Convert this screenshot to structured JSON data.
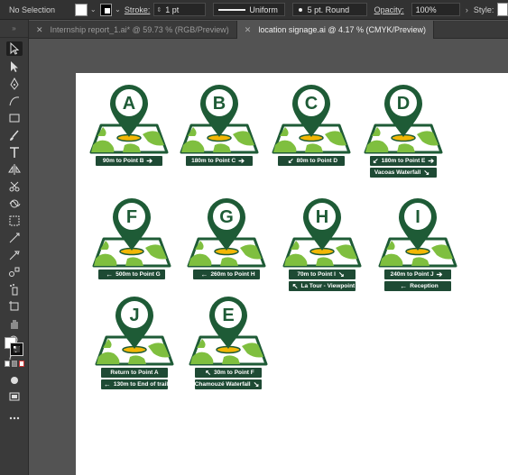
{
  "control_bar": {
    "selection_label": "No Selection",
    "stroke_label": "Stroke:",
    "stroke_value": "1 pt",
    "profile_value": "Uniform",
    "brush_value": "5 pt. Round",
    "opacity_label": "Opacity:",
    "opacity_value": "100%",
    "style_label": "Style:"
  },
  "tabs": [
    {
      "label": "Internship report_1.ai* @ 59.73 % (RGB/Preview)",
      "active": false
    },
    {
      "label": "location signage.ai @ 4.17 % (CMYK/Preview)",
      "active": true
    }
  ],
  "colors": {
    "pin_dark": "#1e5b36",
    "map_light": "#ffffff",
    "map_green": "#7fbf3f",
    "center_yellow": "#f2b705",
    "plate": "#1e4a34"
  },
  "signs": [
    {
      "letter": "A",
      "lines": [
        {
          "text": "90m  to Point B",
          "left_arrow": "",
          "right_arrow": "➔"
        }
      ]
    },
    {
      "letter": "B",
      "lines": [
        {
          "text": "180m  to Point C",
          "left_arrow": "",
          "right_arrow": "➔"
        }
      ]
    },
    {
      "letter": "C",
      "lines": [
        {
          "text": "80m  to Point D",
          "left_arrow": "↙",
          "right_arrow": ""
        }
      ]
    },
    {
      "letter": "D",
      "lines": [
        {
          "text": "180m  to Point E",
          "left_arrow": "↙",
          "right_arrow": "➔"
        },
        {
          "text": "Vacoas Waterfall",
          "left_arrow": "",
          "right_arrow": "↘"
        }
      ]
    },
    {
      "letter": "F",
      "lines": [
        {
          "text": "500m  to Point G",
          "left_arrow": "←",
          "right_arrow": ""
        }
      ]
    },
    {
      "letter": "G",
      "lines": [
        {
          "text": "260m  to Point H",
          "left_arrow": "←",
          "right_arrow": ""
        }
      ]
    },
    {
      "letter": "H",
      "lines": [
        {
          "text": "70m  to Point I",
          "left_arrow": "",
          "right_arrow": "↘"
        },
        {
          "text": "La Tour - Viewpoint",
          "left_arrow": "↖",
          "right_arrow": ""
        }
      ]
    },
    {
      "letter": "I",
      "lines": [
        {
          "text": "240m  to Point J",
          "left_arrow": "",
          "right_arrow": "➔"
        },
        {
          "text": "Reception",
          "left_arrow": "←",
          "right_arrow": ""
        }
      ]
    },
    {
      "letter": "J",
      "lines": [
        {
          "text": "Return to Point A",
          "left_arrow": "",
          "right_arrow": ""
        },
        {
          "text": "130m to End of trail",
          "left_arrow": "←",
          "right_arrow": ""
        }
      ]
    },
    {
      "letter": "E",
      "lines": [
        {
          "text": "30m  to Point F",
          "left_arrow": "↖",
          "right_arrow": ""
        },
        {
          "text": "Chamouzé Waterfall",
          "left_arrow": "",
          "right_arrow": "↘"
        }
      ]
    }
  ]
}
